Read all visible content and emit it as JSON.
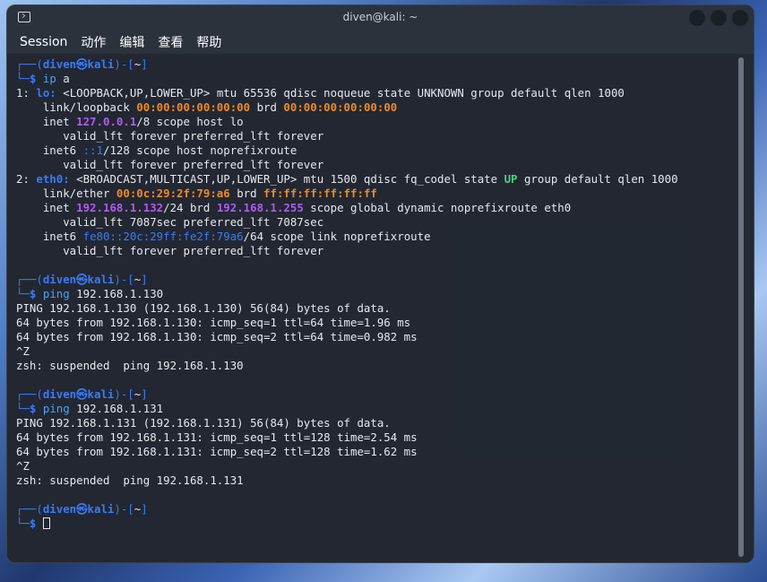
{
  "window": {
    "title": "diven@kali: ~"
  },
  "menu": [
    "Session",
    "动作",
    "编辑",
    "查看",
    "帮助"
  ],
  "prompt": {
    "top": "┌──(",
    "user": "diven",
    "at": "㉿",
    "host": "kali",
    "close": ")-[",
    "dir": "~",
    "end": "]",
    "bottom": "└─",
    "sign": "$"
  },
  "colors": {
    "user": "#3b7bf7",
    "ip": "#b05cf0",
    "mac": "#f08a24",
    "up": "#44d37c",
    "background": "#232a33"
  },
  "terminal": [
    {
      "t": "prompt"
    },
    {
      "t": "cmd",
      "segs": [
        {
          "c": "cmd",
          "x": "ip"
        },
        {
          "x": " a"
        }
      ]
    },
    {
      "segs": [
        {
          "x": "1: "
        },
        {
          "c": "blue",
          "x": "lo:"
        },
        {
          "x": " <LOOPBACK,UP,LOWER_UP> mtu 65536 qdisc noqueue state UNKNOWN group default qlen 1000"
        }
      ]
    },
    {
      "segs": [
        {
          "x": "    link/loopback "
        },
        {
          "c": "orange",
          "x": "00:00:00:00:00:00"
        },
        {
          "x": " brd "
        },
        {
          "c": "orange",
          "x": "00:00:00:00:00:00"
        }
      ]
    },
    {
      "segs": [
        {
          "x": "    inet "
        },
        {
          "c": "purple",
          "x": "127.0.0.1"
        },
        {
          "x": "/8 scope host lo"
        }
      ]
    },
    {
      "segs": [
        {
          "x": "       valid_lft forever preferred_lft forever"
        }
      ]
    },
    {
      "segs": [
        {
          "x": "    inet6 "
        },
        {
          "c": "pb",
          "x": "::1"
        },
        {
          "x": "/128 scope host noprefixroute"
        }
      ]
    },
    {
      "segs": [
        {
          "x": "       valid_lft forever preferred_lft forever"
        }
      ]
    },
    {
      "segs": [
        {
          "x": "2: "
        },
        {
          "c": "blue",
          "x": "eth0:"
        },
        {
          "x": " <BROADCAST,MULTICAST,UP,LOWER_UP> mtu 1500 qdisc fq_codel state "
        },
        {
          "c": "green",
          "x": "UP"
        },
        {
          "x": " group default qlen 1000"
        }
      ]
    },
    {
      "segs": [
        {
          "x": "    link/ether "
        },
        {
          "c": "orange",
          "x": "00:0c:29:2f:79:a6"
        },
        {
          "x": " brd "
        },
        {
          "c": "orange",
          "x": "ff:ff:ff:ff:ff:ff"
        }
      ]
    },
    {
      "segs": [
        {
          "x": "    inet "
        },
        {
          "c": "purple",
          "x": "192.168.1.132"
        },
        {
          "x": "/24 brd "
        },
        {
          "c": "purple",
          "x": "192.168.1.255"
        },
        {
          "x": " scope global dynamic noprefixroute eth0"
        }
      ]
    },
    {
      "segs": [
        {
          "x": "       valid_lft 7087sec preferred_lft 7087sec"
        }
      ]
    },
    {
      "segs": [
        {
          "x": "    inet6 "
        },
        {
          "c": "pb",
          "x": "fe80::20c:29ff:fe2f:79a6"
        },
        {
          "x": "/64 scope link noprefixroute"
        }
      ]
    },
    {
      "segs": [
        {
          "x": "       valid_lft forever preferred_lft forever"
        }
      ]
    },
    {
      "segs": [
        {
          "x": ""
        }
      ]
    },
    {
      "t": "prompt"
    },
    {
      "t": "cmd",
      "segs": [
        {
          "c": "cmd",
          "x": "ping"
        },
        {
          "x": " 192.168.1.130"
        }
      ]
    },
    {
      "segs": [
        {
          "x": "PING 192.168.1.130 (192.168.1.130) 56(84) bytes of data."
        }
      ]
    },
    {
      "segs": [
        {
          "x": "64 bytes from 192.168.1.130: icmp_seq=1 ttl=64 time=1.96 ms"
        }
      ]
    },
    {
      "segs": [
        {
          "x": "64 bytes from 192.168.1.130: icmp_seq=2 ttl=64 time=0.982 ms"
        }
      ]
    },
    {
      "segs": [
        {
          "x": "^Z"
        }
      ]
    },
    {
      "segs": [
        {
          "x": "zsh: suspended  ping 192.168.1.130"
        }
      ]
    },
    {
      "segs": [
        {
          "x": ""
        }
      ]
    },
    {
      "t": "prompt"
    },
    {
      "t": "cmd",
      "segs": [
        {
          "c": "cmd",
          "x": "ping"
        },
        {
          "x": " 192.168.1.131"
        }
      ]
    },
    {
      "segs": [
        {
          "x": "PING 192.168.1.131 (192.168.1.131) 56(84) bytes of data."
        }
      ]
    },
    {
      "segs": [
        {
          "x": "64 bytes from 192.168.1.131: icmp_seq=1 ttl=128 time=2.54 ms"
        }
      ]
    },
    {
      "segs": [
        {
          "x": "64 bytes from 192.168.1.131: icmp_seq=2 ttl=128 time=1.62 ms"
        }
      ]
    },
    {
      "segs": [
        {
          "x": "^Z"
        }
      ]
    },
    {
      "segs": [
        {
          "x": "zsh: suspended  ping 192.168.1.131"
        }
      ]
    },
    {
      "segs": [
        {
          "x": ""
        }
      ]
    },
    {
      "t": "prompt"
    },
    {
      "t": "cmd",
      "cursor": true,
      "segs": []
    }
  ]
}
